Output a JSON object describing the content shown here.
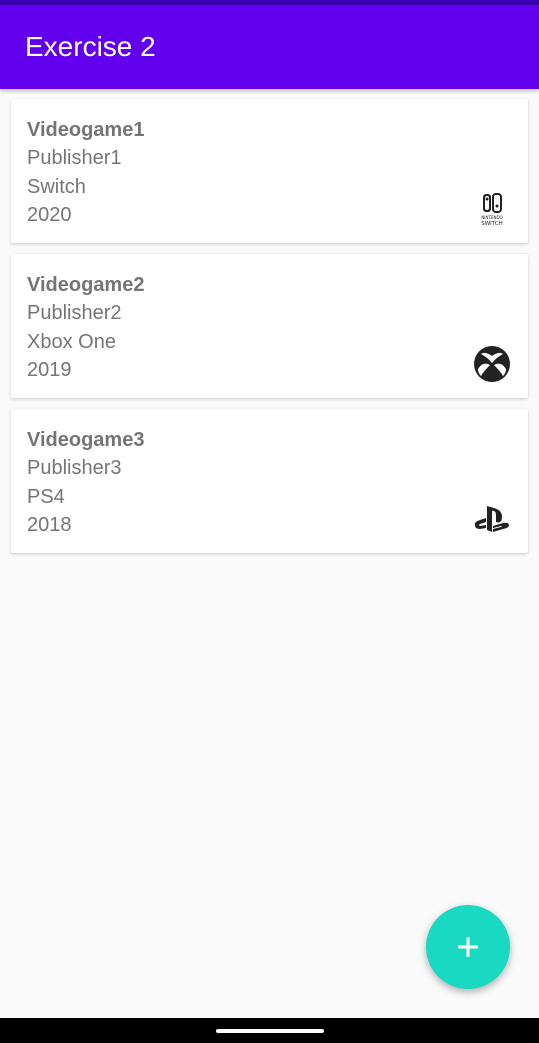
{
  "app_bar": {
    "title": "Exercise 2",
    "color": "#6200ee"
  },
  "games": [
    {
      "title": "Videogame1",
      "publisher": "Publisher1",
      "platform": "Switch",
      "year": "2020",
      "icon": "nintendo-switch-icon",
      "icon_text": "NINTENDO SWITCH"
    },
    {
      "title": "Videogame2",
      "publisher": "Publisher2",
      "platform": "Xbox One",
      "year": "2019",
      "icon": "xbox-icon"
    },
    {
      "title": "Videogame3",
      "publisher": "Publisher3",
      "platform": "PS4",
      "year": "2018",
      "icon": "playstation-icon"
    }
  ],
  "fab": {
    "icon": "plus-icon",
    "color": "#19d9c2"
  }
}
